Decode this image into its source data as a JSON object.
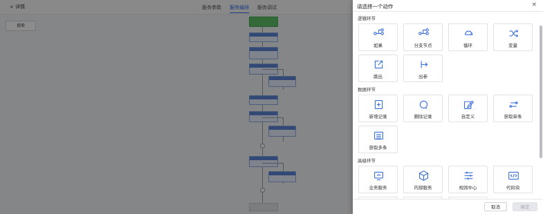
{
  "background": {
    "back_label": "< 详情",
    "tabs": [
      {
        "label": "服务参数",
        "active": false
      },
      {
        "label": "服务编排",
        "active": true
      },
      {
        "label": "服务调试",
        "active": false
      }
    ],
    "search_button": "搜索"
  },
  "panel": {
    "title": "请选择一个动作",
    "close_glyph": "×",
    "sections": [
      {
        "title": "逻辑环节",
        "items": [
          {
            "label": "如果",
            "icon": "if-branch-icon"
          },
          {
            "label": "分支节点",
            "icon": "branch-node-icon"
          },
          {
            "label": "循环",
            "icon": "loop-icon"
          },
          {
            "label": "变量",
            "icon": "variable-icon"
          },
          {
            "label": "跳出",
            "icon": "break-out-icon"
          },
          {
            "label": "出参",
            "icon": "output-param-icon"
          }
        ]
      },
      {
        "title": "数据环节",
        "items": [
          {
            "label": "新增记录",
            "icon": "add-record-icon"
          },
          {
            "label": "删除记录",
            "icon": "delete-record-icon"
          },
          {
            "label": "自定义",
            "icon": "custom-edit-icon"
          },
          {
            "label": "获取单条",
            "icon": "get-single-icon"
          },
          {
            "label": "获取多条",
            "icon": "get-multiple-icon"
          }
        ]
      },
      {
        "title": "高级环节",
        "items": [
          {
            "label": "业务服务",
            "icon": "business-service-icon"
          },
          {
            "label": "内部服务",
            "icon": "internal-service-icon"
          },
          {
            "label": "规则中心",
            "icon": "rule-center-icon"
          },
          {
            "label": "代码块",
            "icon": "code-block-icon"
          }
        ]
      }
    ],
    "footer": {
      "cancel": "取消",
      "confirm": "确定"
    }
  },
  "colors": {
    "accent": "#2f6ee8",
    "icon": "#3a6fd8"
  }
}
